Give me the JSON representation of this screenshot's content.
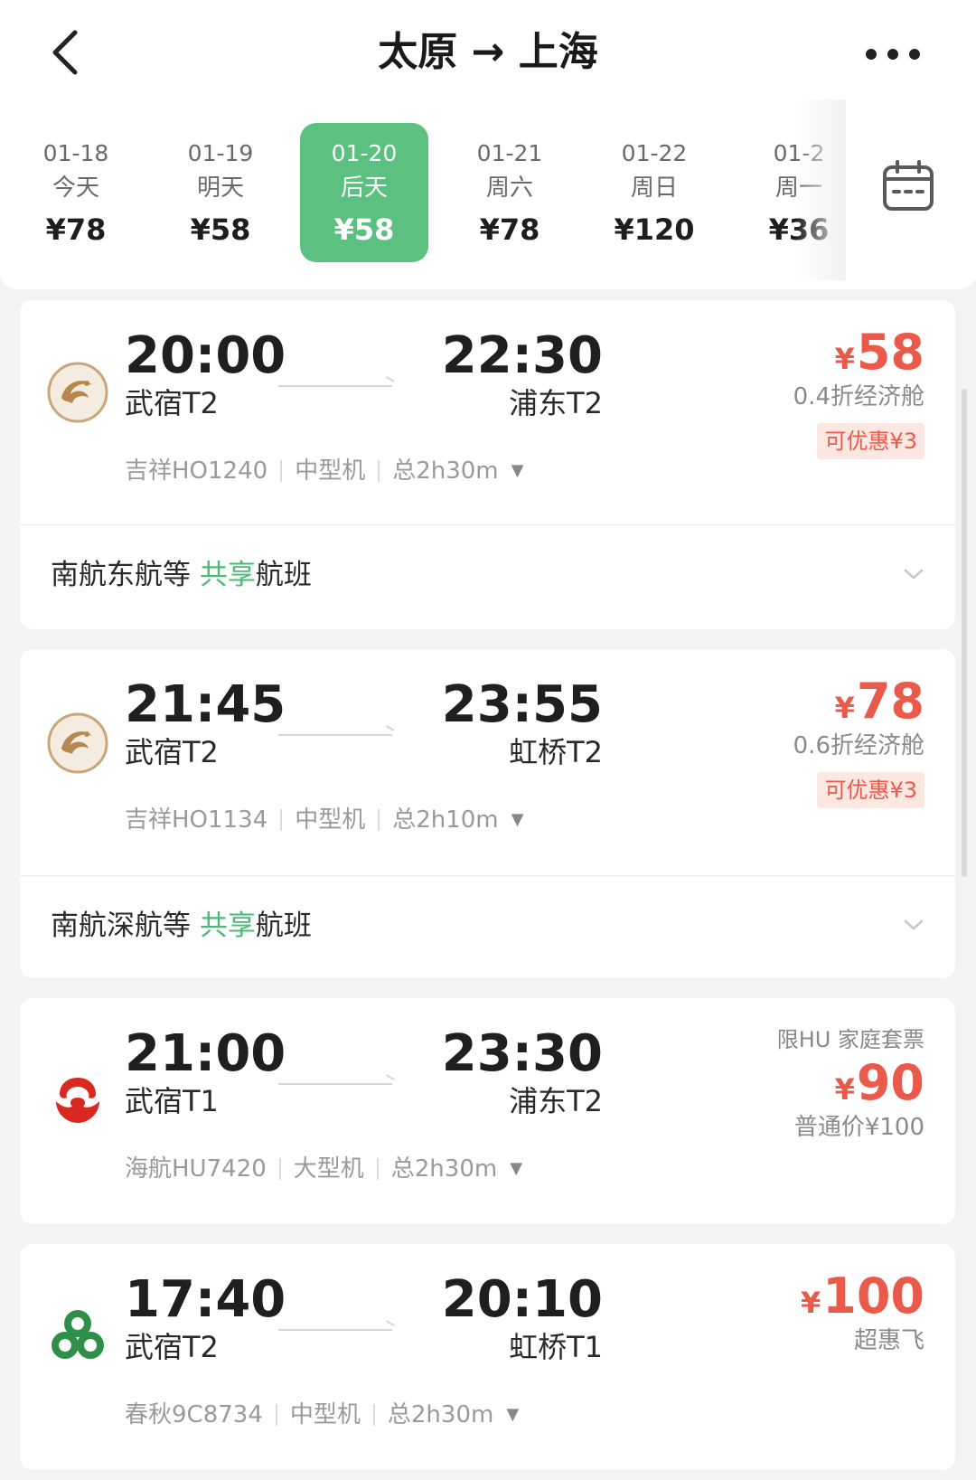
{
  "header": {
    "title": "太原 → 上海",
    "back_icon": "chevron-left-icon",
    "more_icon": "more-dots-icon"
  },
  "dates": [
    {
      "date": "01-18",
      "weekday": "今天",
      "price": "¥78",
      "active": false
    },
    {
      "date": "01-19",
      "weekday": "明天",
      "price": "¥58",
      "active": false
    },
    {
      "date": "01-20",
      "weekday": "后天",
      "price": "¥58",
      "active": true
    },
    {
      "date": "01-21",
      "weekday": "周六",
      "price": "¥78",
      "active": false
    },
    {
      "date": "01-22",
      "weekday": "周日",
      "price": "¥120",
      "active": false
    },
    {
      "date": "01-2",
      "weekday": "周一",
      "price": "¥36",
      "active": false
    }
  ],
  "calendar": {
    "icon": "calendar-icon",
    "chevron": "chevron-down-icon"
  },
  "colors": {
    "accent_green": "#5bc080",
    "price_red": "#ea5a4b",
    "share_green": "#4fb877"
  },
  "flights": [
    {
      "airline_logo": "juneyao-phoenix-logo",
      "dep_time": "20:00",
      "dep_airport": "武宿T2",
      "arr_time": "22:30",
      "arr_airport": "浦东T2",
      "flight_no": "吉祥HO1240",
      "aircraft": "中型机",
      "duration": "总2h30m",
      "currency": "¥",
      "price": "58",
      "cabin": "0.4折经济舱",
      "promo": "可优惠¥3",
      "share": {
        "prefix": "南航东航等 ",
        "highlight": "共享",
        "suffix": "航班"
      }
    },
    {
      "airline_logo": "juneyao-phoenix-logo",
      "dep_time": "21:45",
      "dep_airport": "武宿T2",
      "arr_time": "23:55",
      "arr_airport": "虹桥T2",
      "flight_no": "吉祥HO1134",
      "aircraft": "中型机",
      "duration": "总2h10m",
      "currency": "¥",
      "price": "78",
      "cabin": "0.6折经济舱",
      "promo": "可优惠¥3",
      "share": {
        "prefix": "南航深航等 ",
        "highlight": "共享",
        "suffix": "航班"
      }
    },
    {
      "airline_logo": "hainan-airlines-logo",
      "dep_time": "21:00",
      "dep_airport": "武宿T1",
      "arr_time": "23:30",
      "arr_airport": "浦东T2",
      "flight_no": "海航HU7420",
      "aircraft": "大型机",
      "duration": "总2h30m",
      "tag": "限HU 家庭套票",
      "currency": "¥",
      "price": "90",
      "cabin": "普通价¥100"
    },
    {
      "airline_logo": "spring-airlines-logo",
      "dep_time": "17:40",
      "dep_airport": "武宿T2",
      "arr_time": "20:10",
      "arr_airport": "虹桥T1",
      "flight_no": "春秋9C8734",
      "aircraft": "中型机",
      "duration": "总2h30m",
      "currency": "¥",
      "price": "100",
      "cabin": "超惠飞"
    }
  ]
}
